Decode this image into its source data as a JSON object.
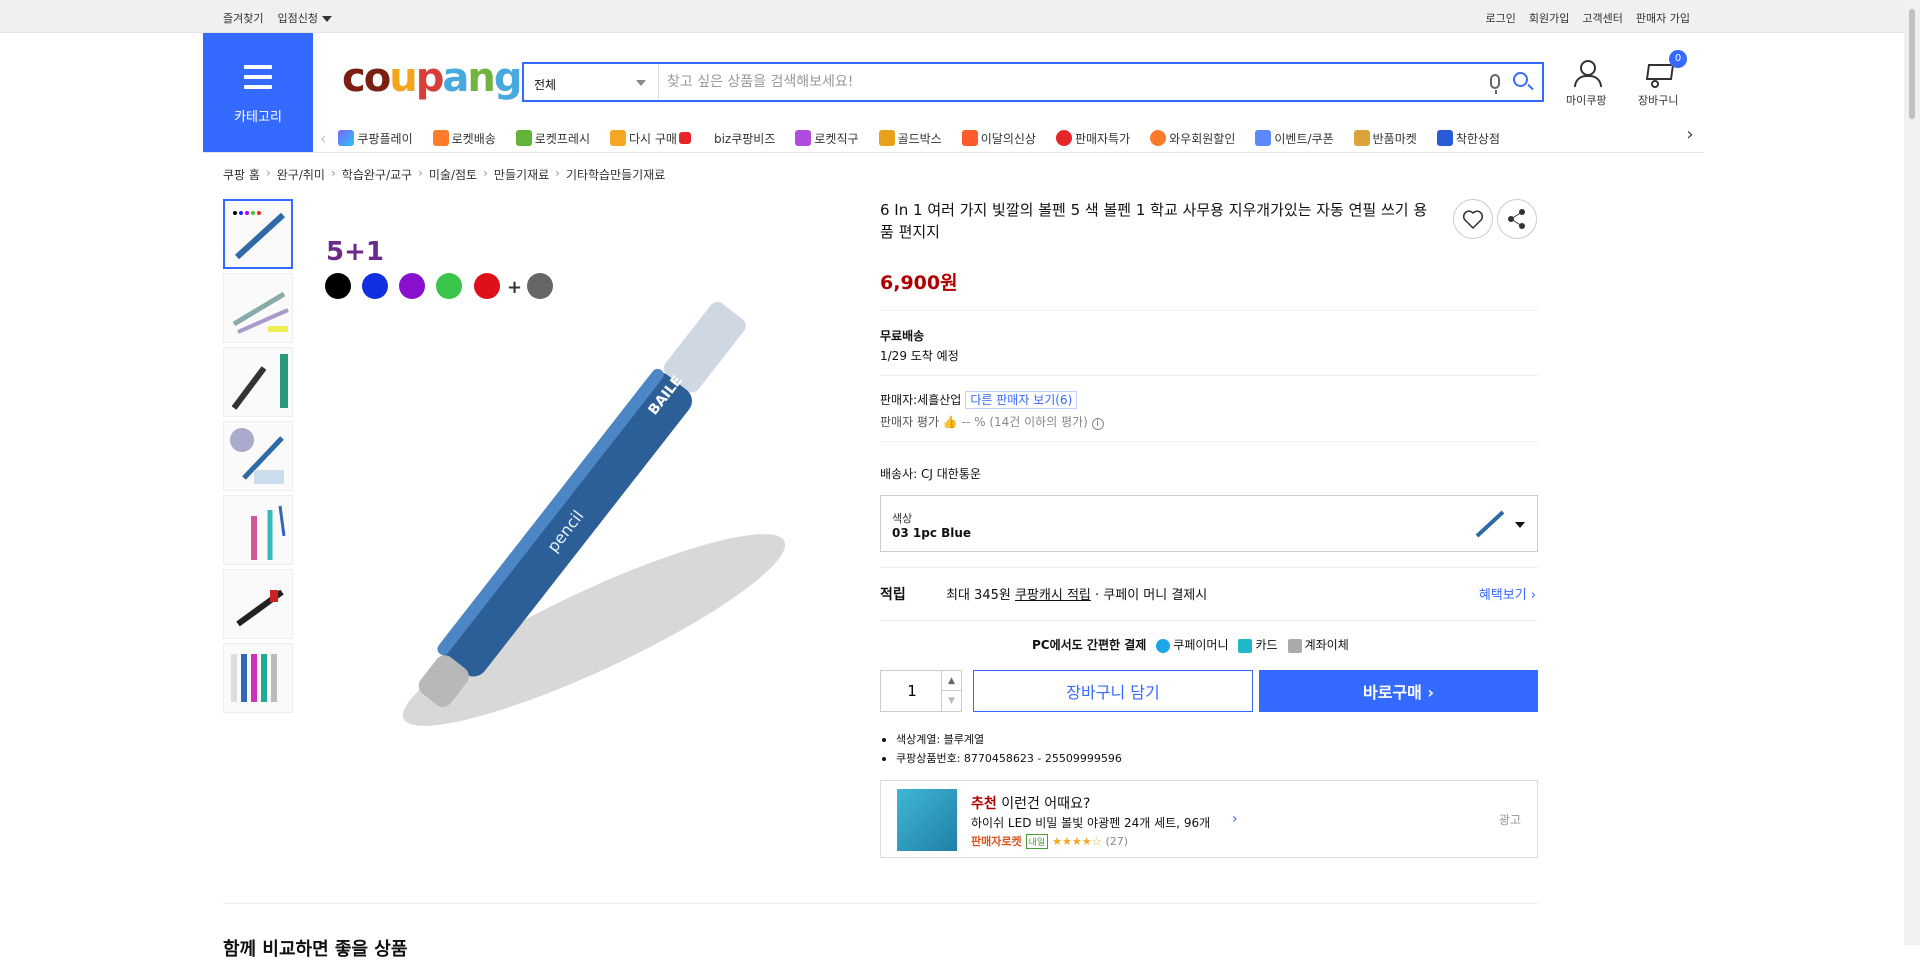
{
  "topbar": {
    "left": [
      "즐겨찾기",
      "입점신청"
    ],
    "right": [
      "로그인",
      "회원가입",
      "고객센터",
      "판매자 가입"
    ]
  },
  "category_button": "카테고리",
  "logo": "coupang",
  "search": {
    "category": "전체",
    "placeholder": "찾고 싶은 상품을 검색해보세요!"
  },
  "header": {
    "mycoupang": "마이쿠팡",
    "cart": "장바구니",
    "cart_count": "0"
  },
  "nav": [
    "쿠팡플레이",
    "로켓배송",
    "로켓프레시",
    "다시 구매",
    "biz쿠팡비즈",
    "로켓직구",
    "골드박스",
    "이달의신상",
    "판매자특가",
    "와우회원할인",
    "이벤트/쿠폰",
    "반품마켓",
    "착한상점"
  ],
  "breadcrumb": [
    "쿠팡 홈",
    "완구/취미",
    "학습완구/교구",
    "미술/점토",
    "만들기재료",
    "기타학습만들기재료"
  ],
  "product": {
    "title": "6 In 1 여러 가지 빛깔의 볼펜 5 색 볼펜 1 학교 사무용 지우개가있는 자동 연필 쓰기 용품 편지지",
    "price": "6,900원",
    "shipping_title": "무료배송",
    "arrival": "1/29 도착 예정",
    "seller_label": "판매자:",
    "seller": "세흘산업",
    "other_sellers": "다른 판매자 보기(6)",
    "seller_rating_label": "판매자 평가",
    "seller_rating_value": "-- % (14건 이하의 평가)",
    "courier_label": "배송사:",
    "courier": "CJ 대한통운",
    "option_label": "색상",
    "option_value": "03 1pc Blue",
    "benefit_label": "적립",
    "benefit_text1": "최대 345원",
    "benefit_link": "쿠팡캐시 적립",
    "benefit_text2": "· 쿠페이 머니 결제시",
    "benefit_more": "혜택보기 ›",
    "pay_title": "PC에서도 간편한 결제",
    "pay_methods": [
      "쿠페이머니",
      "카드",
      "계좌이체"
    ],
    "quantity": "1",
    "cart_button": "장바구니 담기",
    "buy_button": "바로구매 ›",
    "bullets": [
      "색상계열: 블루계열",
      "쿠팡상품번호: 8770458623 - 25509999596"
    ],
    "image_text": {
      "top": "5+1",
      "brand": "BAILE",
      "word": "pencil"
    }
  },
  "recommend": {
    "prefix": "추천",
    "title": " 이런건 어때요?",
    "name": "하이쉬 LED 비밀 볼빛 야광펜 24개 세트, 96개",
    "badge1": "판매자로켓",
    "badge2": "내일",
    "reviews": "(27)",
    "ad": "광고"
  },
  "bottom_title": "함께 비교하면 좋을 상품",
  "colors": {
    "accent": "#346aff",
    "price": "#ae0000"
  }
}
